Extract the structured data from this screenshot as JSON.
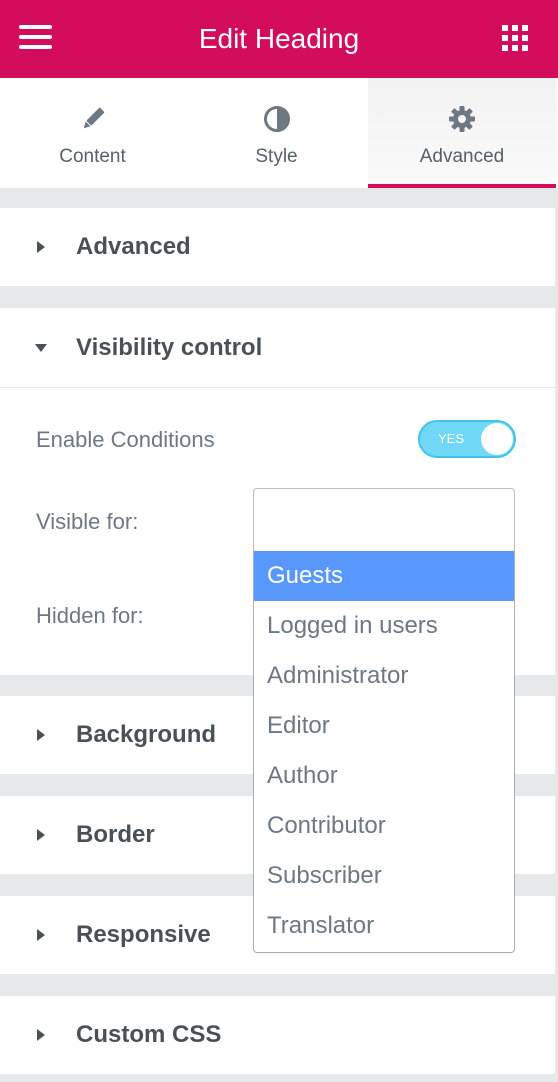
{
  "header": {
    "title": "Edit Heading",
    "menu_icon": "hamburger-icon",
    "apps_icon": "grid-icon",
    "color": "#d30c5c"
  },
  "tabs": [
    {
      "label": "Content",
      "icon": "pencil-icon"
    },
    {
      "label": "Style",
      "icon": "half-circle-icon"
    },
    {
      "label": "Advanced",
      "icon": "gear-icon",
      "active": true
    }
  ],
  "sections": {
    "advanced": "Advanced",
    "visibility": "Visibility control",
    "background": "Background",
    "border": "Border",
    "responsive": "Responsive",
    "custom_css": "Custom CSS"
  },
  "visibility": {
    "enable_label": "Enable Conditions",
    "toggle_text": "YES",
    "visible_for_label": "Visible for:",
    "visible_for_value": "",
    "hidden_for_label": "Hidden for:",
    "options": [
      "Guests",
      "Logged in users",
      "Administrator",
      "Editor",
      "Author",
      "Contributor",
      "Subscriber",
      "Translator"
    ],
    "highlighted_option": "Guests"
  },
  "colors": {
    "accent": "#d30c5c",
    "toggle": "#71d7f7",
    "highlight": "#5897fb"
  }
}
